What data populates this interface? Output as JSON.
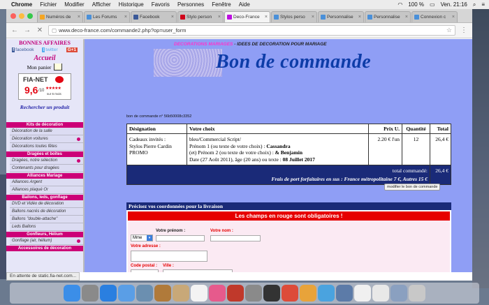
{
  "menubar": {
    "app": "Chrome",
    "items": [
      "Fichier",
      "Modifier",
      "Afficher",
      "Historique",
      "Favoris",
      "Personnes",
      "Fenêtre",
      "Aide"
    ],
    "battery": "100 %",
    "clock": "Ven. 21:16"
  },
  "tabs": [
    {
      "title": "Numéros de",
      "color": "#f5a623"
    },
    {
      "title": "Les Forums",
      "color": "#4a90d9"
    },
    {
      "title": "Facebook",
      "color": "#3b5998"
    },
    {
      "title": "Stylo person",
      "color": "#d0021b"
    },
    {
      "title": "Deco-France",
      "color": "#bd10e0",
      "active": true
    },
    {
      "title": "Stylos perso",
      "color": "#4a90d9"
    },
    {
      "title": "Personnalise",
      "color": "#4a90d9"
    },
    {
      "title": "Personnalise",
      "color": "#4a90d9"
    },
    {
      "title": "Connexion c",
      "color": "#4a90d9"
    }
  ],
  "address": {
    "url": "www.deco-france.com/commande2.php?op=user_form"
  },
  "sidebar": {
    "title": "BONNES AFFAIRES",
    "social": {
      "facebook": "facebook",
      "twitter": "twitter",
      "gplus": "G+1"
    },
    "home": "Accueil",
    "cart": "Mon panier",
    "fianet": {
      "brand": "FIA-NET",
      "score": "9,6",
      "out_of": "/10",
      "sub": "sur 6 mois"
    },
    "search": "Rechercher un produit",
    "menu": [
      {
        "category": "Kits de décoration",
        "items": [
          {
            "label": "Décoration de la salle",
            "dot": false
          },
          {
            "label": "Décoration voitures",
            "dot": true
          },
          {
            "label": "Décorations toutes fêtes",
            "dot": false
          }
        ]
      },
      {
        "category": "Dragées et boîtes",
        "items": [
          {
            "label": "Dragées, notre sélection",
            "dot": true
          },
          {
            "label": "Contenants pour dragées",
            "dot": false
          }
        ]
      },
      {
        "category": "Alliances Mariage",
        "items": [
          {
            "label": "Alliances Argent",
            "dot": false
          },
          {
            "label": "Alliances plaqué Or",
            "dot": false
          }
        ]
      },
      {
        "category": "Ballons, leds, gonflage",
        "items": [
          {
            "label": "DVD et Vidéo de décoration",
            "dot": false
          },
          {
            "label": "Ballons nacrés de décoration",
            "dot": false
          },
          {
            "label": "Ballons \"double-attache\"",
            "dot": false
          },
          {
            "label": "Leds Ballons",
            "dot": false
          }
        ]
      },
      {
        "category": "Gonfleurs, Hélium",
        "items": [
          {
            "label": "Gonflage (air, hélium)",
            "dot": true
          }
        ]
      },
      {
        "category": "Accessoires de décoration",
        "items": []
      }
    ]
  },
  "header": {
    "link1": "DECORATIONS MARIAGES",
    "separator": " - ",
    "link2": "IDEES DE DECORATION POUR MARIAGE",
    "title": "Bon de commande"
  },
  "order": {
    "ref": "bon de commande n° 56b50008c3352",
    "columns": {
      "designation": "Désignation",
      "choice": "Votre choix",
      "price": "Prix U.",
      "qty": "Quantité",
      "total": "Total"
    },
    "row": {
      "designation_lines": [
        "Cadeaux invités :",
        "Stylos Pierre Cardin",
        "PROMO"
      ],
      "choice_line1": "bleu/Commercial Script/",
      "choice_line2_prefix": "Prénom 1 (ou texte de votre choix) : ",
      "choice_line2_value": "Cassandra",
      "choice_line3_prefix": "(et) Prénom 2 (ou texte de votre choix) : ",
      "choice_line3_value": "& Benjamin",
      "choice_line4_prefix": "Date (27 Août 2011), âge (20 ans) ou texte : ",
      "choice_line4_value": "08 Juillet 2017",
      "price": "2.20 € l'un",
      "qty": "12",
      "total": "26,4 €"
    },
    "total_label": "total commandé:",
    "total_value": "26,4 €",
    "shipping": "Frais de port forfaitaires en sus : France métropolitaine 7 €, Autres 15 €",
    "modify_button": "modifier le bon de commande"
  },
  "delivery": {
    "heading": "Précisez vos coordonnées pour la livraison",
    "required_notice": "Les champs en rouge sont obligatoires !",
    "civility": "Mme",
    "firstname_label": "Votre prénom :",
    "lastname_label": "Votre nom :",
    "address_label": "Votre adresse :",
    "zip_label": "Code postal :",
    "city_label": "Ville :"
  },
  "status": "En attente de static.fia-net.com...",
  "dock": [
    {
      "name": "finder-icon",
      "color": "#3b8ee8"
    },
    {
      "name": "launchpad-icon",
      "color": "#8a8a8a"
    },
    {
      "name": "app-store-icon",
      "color": "#2a7fe0"
    },
    {
      "name": "mail-icon",
      "color": "#5a9ee6"
    },
    {
      "name": "preview-icon",
      "color": "#6b8fb0"
    },
    {
      "name": "books-icon",
      "color": "#b07a3a"
    },
    {
      "name": "contacts-icon",
      "color": "#c8a878"
    },
    {
      "name": "calendar-icon",
      "color": "#f3f3f3"
    },
    {
      "name": "itunes-icon",
      "color": "#e65a8c"
    },
    {
      "name": "photo-booth-icon",
      "color": "#c0392b"
    },
    {
      "name": "system-preferences-icon",
      "color": "#8a8a8a"
    },
    {
      "name": "activity-monitor-icon",
      "color": "#333333"
    },
    {
      "name": "chrome-icon",
      "color": "#dd4b39"
    },
    {
      "name": "photos-icon",
      "color": "#e8a33a"
    },
    {
      "name": "xcode-icon",
      "color": "#4aa3df"
    },
    {
      "name": "finder-window-icon",
      "color": "#5c7ba8"
    },
    {
      "name": "document-icon",
      "color": "#f0f0f0"
    },
    {
      "name": "document-icon",
      "color": "#e8e8e8"
    },
    {
      "name": "download-icon",
      "color": "#8aa0c0"
    },
    {
      "name": "trash-icon",
      "color": "#c8c8c8"
    }
  ]
}
